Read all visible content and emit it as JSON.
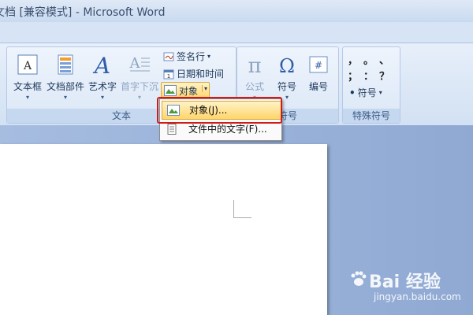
{
  "window": {
    "title": "文档 [兼容模式] - Microsoft Word"
  },
  "ribbon": {
    "buttons": {
      "textbox": "文本框",
      "quickparts": "文档部件",
      "wordart": "艺术字",
      "dropcap": "首字下沉",
      "equation": "公式",
      "symbol": "符号",
      "number": "编号"
    },
    "small": {
      "signature": "签名行",
      "datetime": "日期和时间",
      "object": "对象"
    },
    "groups": {
      "text": "文本",
      "symbols": "符号",
      "special": "特殊符号"
    },
    "special_symbols": {
      "row1": [
        "，",
        "。",
        "、"
      ],
      "row2": [
        "；",
        "：",
        "？"
      ],
      "symbol_label": "符号"
    }
  },
  "dropdown": {
    "items": [
      {
        "label": "对象(J)...",
        "selected": true
      },
      {
        "label": "文件中的文字(F)...",
        "selected": false
      }
    ]
  },
  "watermark": {
    "brand": "Bai 经验",
    "site": "jingyan.baidu.com"
  },
  "colors": {
    "highlight": "#ffd56c",
    "annotation": "#d11b1b",
    "ribbon_bg": "#dfeaf8"
  }
}
